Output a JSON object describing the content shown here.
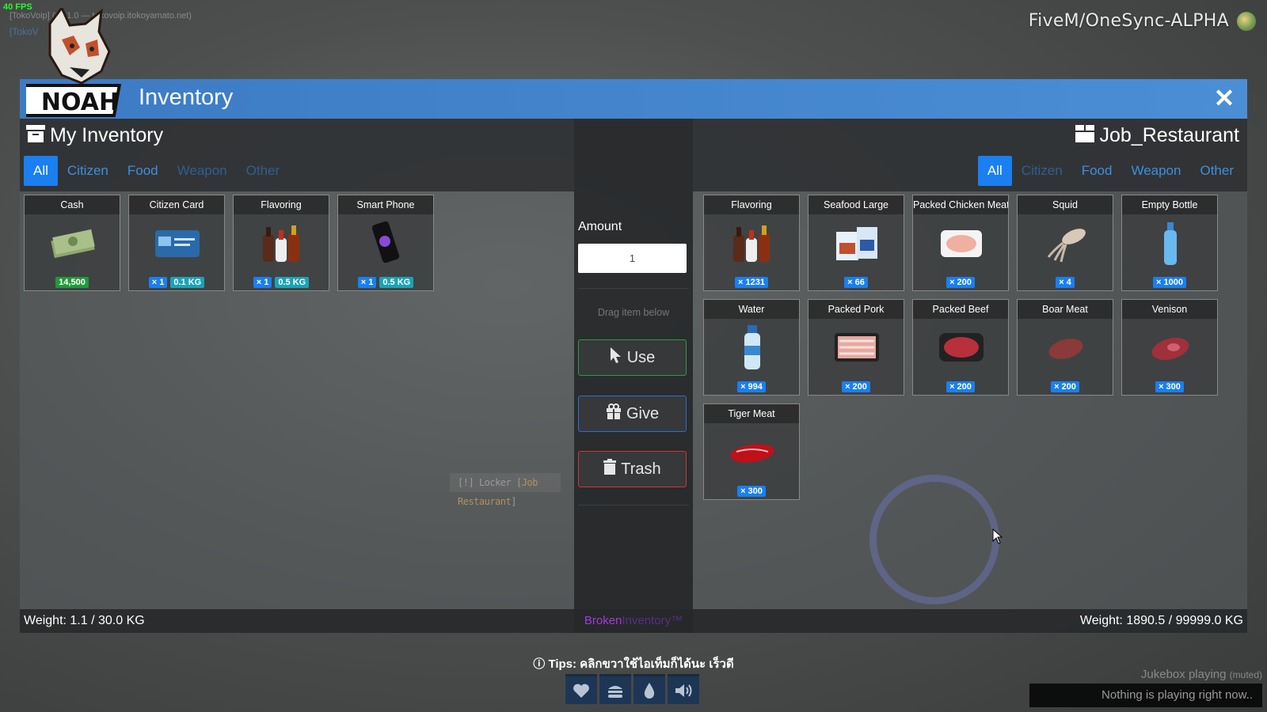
{
  "overlay": {
    "fps": "40 FPS",
    "server_line1": "[TokoVoip] (v1.1.0 — tokovoip.itokoyamato.net)",
    "server_line2": "[TokoV"
  },
  "server_name": "FiveM/OneSync-ALPHA",
  "window": {
    "title": "Inventory",
    "logo_text": "NOAH",
    "close_icon": "close-icon"
  },
  "left": {
    "heading": "My Inventory",
    "tabs": [
      "All",
      "Citizen",
      "Food",
      "Weapon",
      "Other"
    ],
    "items": [
      {
        "name": "Cash",
        "icon": "cash-icon",
        "badges": [
          {
            "type": "money",
            "text": "14,500"
          }
        ]
      },
      {
        "name": "Citizen Card",
        "icon": "id-card-icon",
        "badges": [
          {
            "type": "qty",
            "text": "× 1"
          },
          {
            "type": "wt",
            "text": "0.1 KG"
          }
        ]
      },
      {
        "name": "Flavoring",
        "icon": "sauce-bottles-icon",
        "badges": [
          {
            "type": "qty",
            "text": "× 1"
          },
          {
            "type": "wt",
            "text": "0.5 KG"
          }
        ]
      },
      {
        "name": "Smart Phone",
        "icon": "phone-icon",
        "badges": [
          {
            "type": "qty",
            "text": "× 1"
          },
          {
            "type": "wt",
            "text": "0.5 KG"
          }
        ]
      }
    ],
    "weight": "Weight: 1.1 / 30.0 KG"
  },
  "middle": {
    "amount_label": "Amount",
    "amount_value": "1",
    "drag_hint": "Drag item below",
    "use_label": "Use",
    "give_label": "Give",
    "trash_label": "Trash",
    "brand_a": "Broken",
    "brand_b": "Inventory™"
  },
  "right": {
    "heading": "Job_Restaurant",
    "tabs": [
      "All",
      "Citizen",
      "Food",
      "Weapon",
      "Other"
    ],
    "items": [
      {
        "name": "Flavoring",
        "icon": "sauce-bottles-icon",
        "badges": [
          {
            "type": "qty",
            "text": "× 1231"
          }
        ]
      },
      {
        "name": "Seafood Large",
        "icon": "seafood-pack-icon",
        "badges": [
          {
            "type": "qty",
            "text": "× 66"
          }
        ]
      },
      {
        "name": "Packed Chicken Meat",
        "icon": "chicken-pack-icon",
        "badges": [
          {
            "type": "qty",
            "text": "× 200"
          }
        ]
      },
      {
        "name": "Squid",
        "icon": "squid-icon",
        "badges": [
          {
            "type": "qty",
            "text": "× 4"
          }
        ]
      },
      {
        "name": "Empty Bottle",
        "icon": "bottle-icon",
        "badges": [
          {
            "type": "qty",
            "text": "× 1000"
          }
        ]
      },
      {
        "name": "Water",
        "icon": "water-bottle-icon",
        "badges": [
          {
            "type": "qty",
            "text": "× 994"
          }
        ]
      },
      {
        "name": "Packed Pork",
        "icon": "pork-pack-icon",
        "badges": [
          {
            "type": "qty",
            "text": "× 200"
          }
        ]
      },
      {
        "name": "Packed Beef",
        "icon": "beef-pack-icon",
        "badges": [
          {
            "type": "qty",
            "text": "× 200"
          }
        ]
      },
      {
        "name": "Boar Meat",
        "icon": "boar-meat-icon",
        "badges": [
          {
            "type": "qty",
            "text": "× 200"
          }
        ]
      },
      {
        "name": "Venison",
        "icon": "venison-icon",
        "badges": [
          {
            "type": "qty",
            "text": "× 300"
          }
        ]
      },
      {
        "name": "Tiger Meat",
        "icon": "tiger-meat-icon",
        "badges": [
          {
            "type": "qty",
            "text": "× 300"
          }
        ]
      }
    ],
    "weight": "Weight: 1890.5 / 99999.0 KG"
  },
  "locker": {
    "prefix": "[!] Locker [",
    "name": "Job Restaurant",
    "suffix": "]"
  },
  "tips": "Tips: คลิกขวาใช้ไอเท็มก็ได้นะ เร็วดี",
  "hud": [
    "heart-icon",
    "burger-icon",
    "water-drop-icon",
    "speaker-icon"
  ],
  "jukebox": {
    "title": "Jukebox playing",
    "muted": "(muted)",
    "status": "Nothing is playing right now.."
  },
  "colors": {
    "accent": "#1a7ff0",
    "titlebar": "#4288d0",
    "use": "#2f9a48",
    "give": "#2d6fd0",
    "trash": "#d03535",
    "brand": "#a03ae0"
  }
}
